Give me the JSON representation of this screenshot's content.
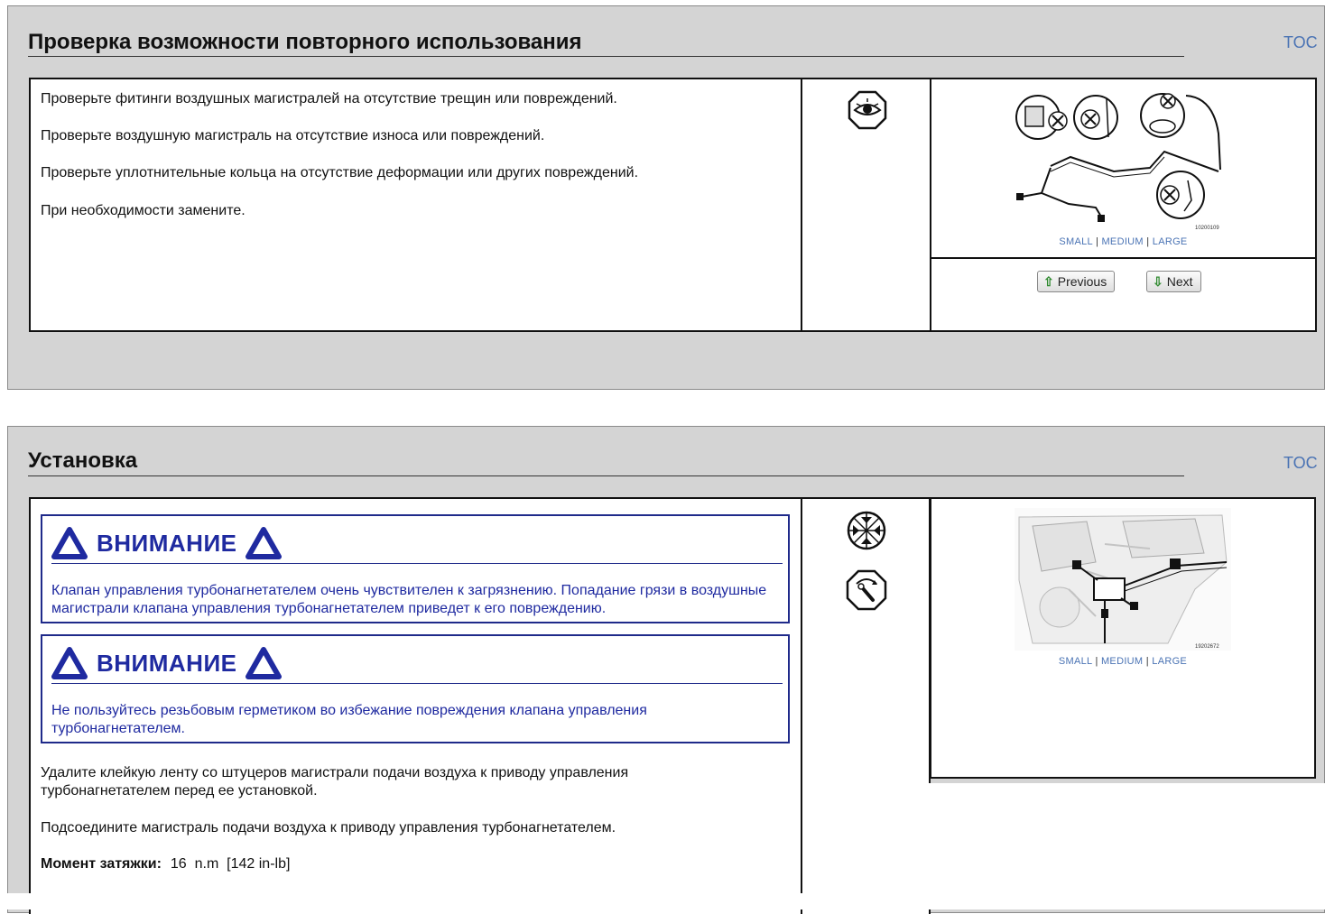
{
  "section1": {
    "title": "Проверка возможности повторного использования",
    "toc": "TOC",
    "paragraphs": [
      "Проверьте фитинги воздушных магистралей на отсутствие трещин или повреждений.",
      "Проверьте воздушную магистраль на отсутствие износа или повреждений.",
      "Проверьте уплотнительные кольца на отсутствие деформации или других повреждений.",
      "При необходимости замените."
    ],
    "icon": "eye-inspect-icon",
    "image_number": "10200109",
    "size_links": {
      "small": "SMALL",
      "medium": "MEDIUM",
      "large": "LARGE",
      "sep": "|"
    },
    "previous_label": "Previous",
    "next_label": "Next"
  },
  "section2": {
    "title": "Установка",
    "toc": "TOC",
    "warnings": [
      {
        "heading": "ВНИМАНИЕ",
        "text": "Клапан управления турбонагнетателем очень чувствителен к загрязнению. Попадание грязи в воздушные магистрали клапана управления турбонагнетателем приведет к его повреждению."
      },
      {
        "heading": "ВНИМАНИЕ",
        "text": "Не пользуйтесь резьбовым герметиком во избежание повреждения клапана управления турбонагнетателем."
      }
    ],
    "paragraphs": [
      "Удалите клейкую ленту со штуцеров магистрали подачи воздуха к приводу управления турбонагнетателем перед ее установкой.",
      "Подсоедините магистраль подачи воздуха к приводу управления турбонагнетателем."
    ],
    "torque": {
      "label": "Момент затяжки:",
      "value": "16  n.m  [142 in-lb]"
    },
    "icons": [
      "clean-parts-icon",
      "torque-wrench-icon"
    ],
    "image_number": "19202672",
    "size_links": {
      "small": "SMALL",
      "medium": "MEDIUM",
      "large": "LARGE",
      "sep": "|"
    }
  },
  "colors": {
    "panel_bg": "#d4d4d4",
    "link": "#4a73b4",
    "warning_blue": "#1f2aa0"
  }
}
